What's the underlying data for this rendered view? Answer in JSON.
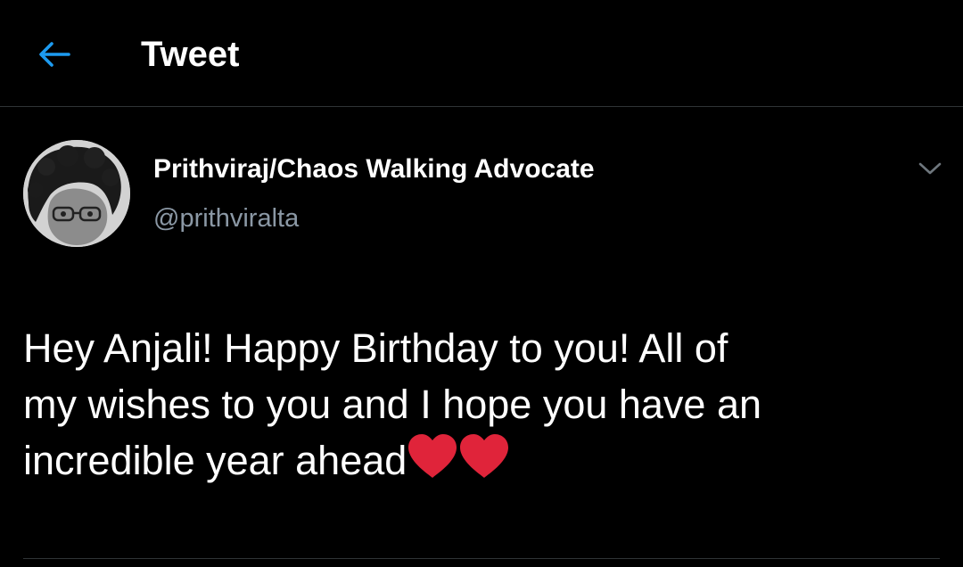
{
  "header": {
    "back_icon": "arrow-left-icon",
    "title": "Tweet",
    "accent_color": "#1d9bf0"
  },
  "tweet": {
    "author": {
      "display_name": "Prithviraj/Chaos Walking Advocate",
      "handle": "@prithviralta",
      "avatar_icon": "avatar"
    },
    "more_icon": "chevron-down-icon",
    "text_lines": [
      "Hey Anjali! Happy Birthday to you! All of",
      "my wishes to you and I hope you have an",
      "incredible year ahead"
    ],
    "emoji": [
      "red-heart-icon",
      "red-heart-icon"
    ],
    "heart_color": "#e0243a"
  }
}
